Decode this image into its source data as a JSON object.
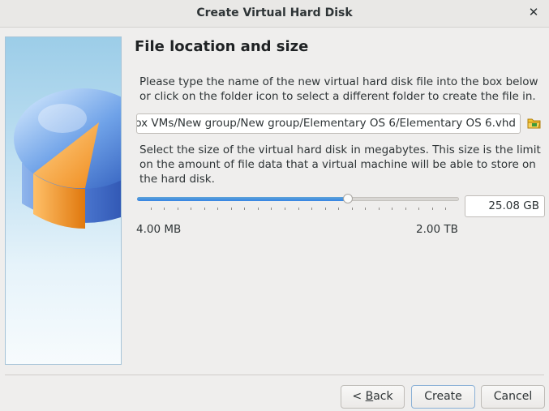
{
  "window": {
    "title": "Create Virtual Hard Disk"
  },
  "page": {
    "heading": "File location and size",
    "location_description": "Please type the name of the new virtual hard disk file into the box below or click on the folder icon to select a different folder to create the file in.",
    "file_path": "ox VMs/New group/New group/Elementary OS 6/Elementary OS 6.vhd",
    "size_description": "Select the size of the virtual hard disk in megabytes. This size is the limit on the amount of file data that a virtual machine will be able to store on the hard disk.",
    "size_value": "25.08 GB",
    "slider_fraction": 0.655,
    "slider_min_label": "4.00 MB",
    "slider_max_label": "2.00 TB"
  },
  "buttons": {
    "back_prefix": "< ",
    "back_mnemonic": "B",
    "back_rest": "ack",
    "create": "Create",
    "cancel": "Cancel"
  },
  "icons": {
    "close": "close-icon",
    "folder": "folder-open-icon",
    "illustration": "virtual-disk-illustration"
  },
  "colors": {
    "accent": "#3584e4",
    "folder": "#e8a317"
  }
}
